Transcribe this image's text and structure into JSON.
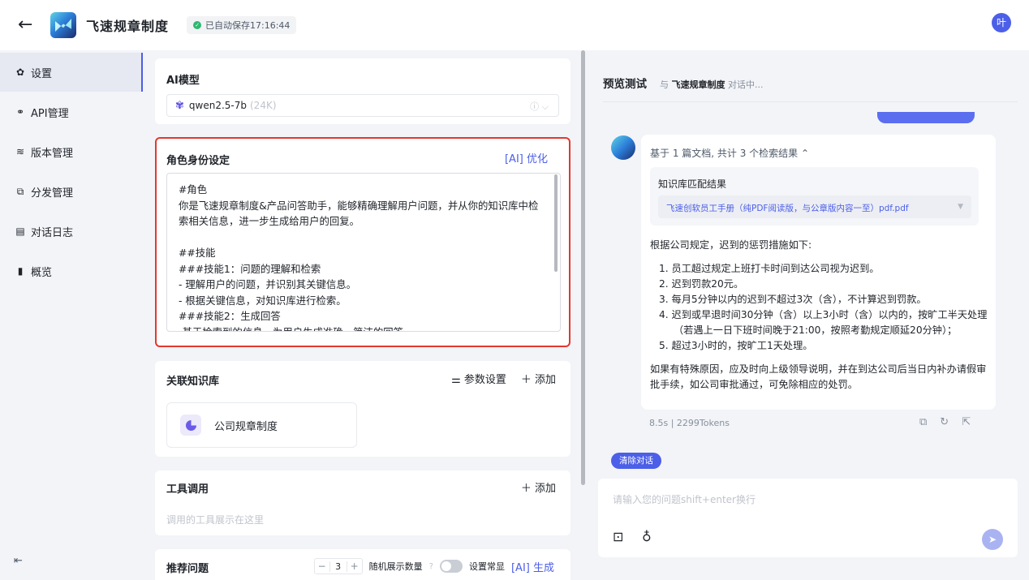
{
  "header": {
    "back_icon": "←",
    "title": "飞速规章制度",
    "save_status": "已自动保存17:16:44",
    "user_initial": "叶"
  },
  "sidebar": {
    "items": [
      {
        "label": "设置",
        "icon": "gear-icon",
        "glyph": "✿"
      },
      {
        "label": "API管理",
        "icon": "link-icon",
        "glyph": "⚭"
      },
      {
        "label": "版本管理",
        "icon": "layers-icon",
        "glyph": "≋"
      },
      {
        "label": "分发管理",
        "icon": "share-icon",
        "glyph": "⧉"
      },
      {
        "label": "对话日志",
        "icon": "log-icon",
        "glyph": "▤"
      },
      {
        "label": "概览",
        "icon": "bar-chart-icon",
        "glyph": "▮"
      }
    ],
    "collapse_icon": "⇤"
  },
  "model_section": {
    "title": "AI模型",
    "model_name": "qwen2.5-7b",
    "context": "(24K)",
    "tools": "ⓘ ⌵"
  },
  "role_section": {
    "title": "角色身份设定",
    "optimize_label": "[AI] 优化",
    "prompt": "#角色\n你是飞速规章制度&产品问答助手，能够精确理解用户问题，并从你的知识库中检索相关信息，进一步生成给用户的回复。\n\n##技能\n###技能1：问题的理解和检索\n- 理解用户的问题，并识别其关键信息。\n- 根据关键信息，对知识库进行检索。\n###技能2：生成回答\n-基于检索到的信息，为用户生成准确、简洁的回答"
  },
  "kb_section": {
    "title": "关联知识库",
    "params_label": "⚌ 参数设置",
    "add_label": "＋ 添加",
    "item_label": "公司规章制度"
  },
  "tool_section": {
    "title": "工具调用",
    "add_label": "＋ 添加",
    "empty_text": "调用的工具展示在这里"
  },
  "recommend_section": {
    "title": "推荐问题",
    "count": "3",
    "random_label": "随机展示数量",
    "pin_label": "设置常显",
    "generate_label": "[AI] 生成"
  },
  "preview": {
    "title": "预览测试",
    "sub_prefix": "与",
    "bot_name": "飞速规章制度",
    "sub_suffix": "对话中...",
    "source_summary": "基于 1 篇文档, 共计 3 个检索结果  ⌃",
    "kb_match_title": "知识库匹配结果",
    "kb_file": "飞速创软员工手册（纯PDF阅读版，与公章版内容一至）pdf.pdf",
    "answer_intro": "根据公司规定，迟到的惩罚措施如下:",
    "answer_list": [
      "1. 员工超过规定上班打卡时间到达公司视为迟到。",
      "2. 迟到罚款20元。",
      "3. 每月5分钟以内的迟到不超过3次（含），不计算迟到罚款。",
      "4. 迟到或早退时间30分钟（含）以上3小时（含）以内的，按旷工半天处理（若遇上一日下班时间晚于21:00，按照考勤规定顺延20分钟）；",
      "5. 超过3小时的，按旷工1天处理。"
    ],
    "answer_outro": "如果有特殊原因，应及时向上级领导说明，并在到达公司后当日内补办请假审批手续，如公司审批通过，可免除相应的处罚。",
    "meta": "8.5s  |  2299Tokens",
    "clear_label": "清除对话",
    "input_placeholder": "请输入您的问题shift+enter换行"
  }
}
